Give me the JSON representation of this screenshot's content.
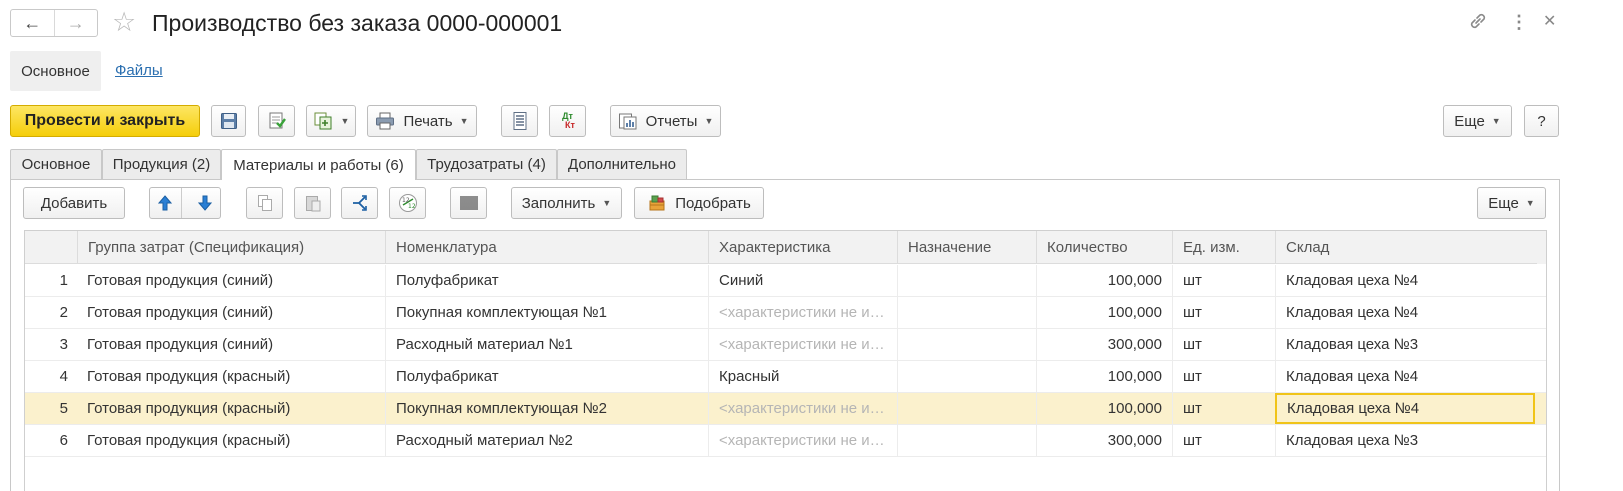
{
  "window": {
    "title": "Производство без заказа 0000-000001",
    "back_icon": "←",
    "forward_icon": "→",
    "star_icon": "☆",
    "link_icon": "🔗",
    "more_icon": "⋮",
    "close_icon": "✕"
  },
  "sections": {
    "main": "Основное",
    "files": "Файлы"
  },
  "toolbar": {
    "post_close": "Провести и закрыть",
    "print": "Печать",
    "reports": "Отчеты",
    "dt_kt_top": "Дт",
    "dt_kt_bottom": "Кт",
    "more": "Еще",
    "help": "?"
  },
  "tabs": [
    {
      "label": "Основное"
    },
    {
      "label": "Продукция (2)"
    },
    {
      "label": "Материалы и работы (6)"
    },
    {
      "label": "Трудозатраты (4)"
    },
    {
      "label": "Дополнительно"
    }
  ],
  "table_toolbar": {
    "add": "Добавить",
    "fill": "Заполнить",
    "pick": "Подобрать",
    "more": "Еще"
  },
  "table": {
    "columns": [
      "Группа затрат (Спецификация)",
      "Номенклатура",
      "Характеристика",
      "Назначение",
      "Количество",
      "Ед. изм.",
      "Склад"
    ],
    "rows": [
      {
        "n": "1",
        "group": "Готовая продукция (синий)",
        "item": "Полуфабрикат",
        "char": "Синий",
        "purpose": "",
        "qty": "100,000",
        "unit": "шт",
        "warehouse": "Кладовая цеха №4"
      },
      {
        "n": "2",
        "group": "Готовая продукция (синий)",
        "item": "Покупная комплектующая №1",
        "char": "<характеристики не и…",
        "purpose": "",
        "qty": "100,000",
        "unit": "шт",
        "warehouse": "Кладовая цеха №4"
      },
      {
        "n": "3",
        "group": "Готовая продукция (синий)",
        "item": "Расходный материал №1",
        "char": "<характеристики не и…",
        "purpose": "",
        "qty": "300,000",
        "unit": "шт",
        "warehouse": "Кладовая цеха №3"
      },
      {
        "n": "4",
        "group": "Готовая продукция (красный)",
        "item": "Полуфабрикат",
        "char": "Красный",
        "purpose": "",
        "qty": "100,000",
        "unit": "шт",
        "warehouse": "Кладовая цеха №4"
      },
      {
        "n": "5",
        "group": "Готовая продукция (красный)",
        "item": "Покупная комплектующая №2",
        "char": "<характеристики не и…",
        "purpose": "",
        "qty": "100,000",
        "unit": "шт",
        "warehouse": "Кладовая цеха №4"
      },
      {
        "n": "6",
        "group": "Готовая продукция (красный)",
        "item": "Расходный материал №2",
        "char": "<характеристики не и…",
        "purpose": "",
        "qty": "300,000",
        "unit": "шт",
        "warehouse": "Кладовая цеха №3"
      }
    ]
  },
  "colors": {
    "accent_yellow": "#f5ce0a",
    "selected_row": "#fbf1cd",
    "focus_border": "#f0c419",
    "link_blue": "#2b6fb0"
  }
}
